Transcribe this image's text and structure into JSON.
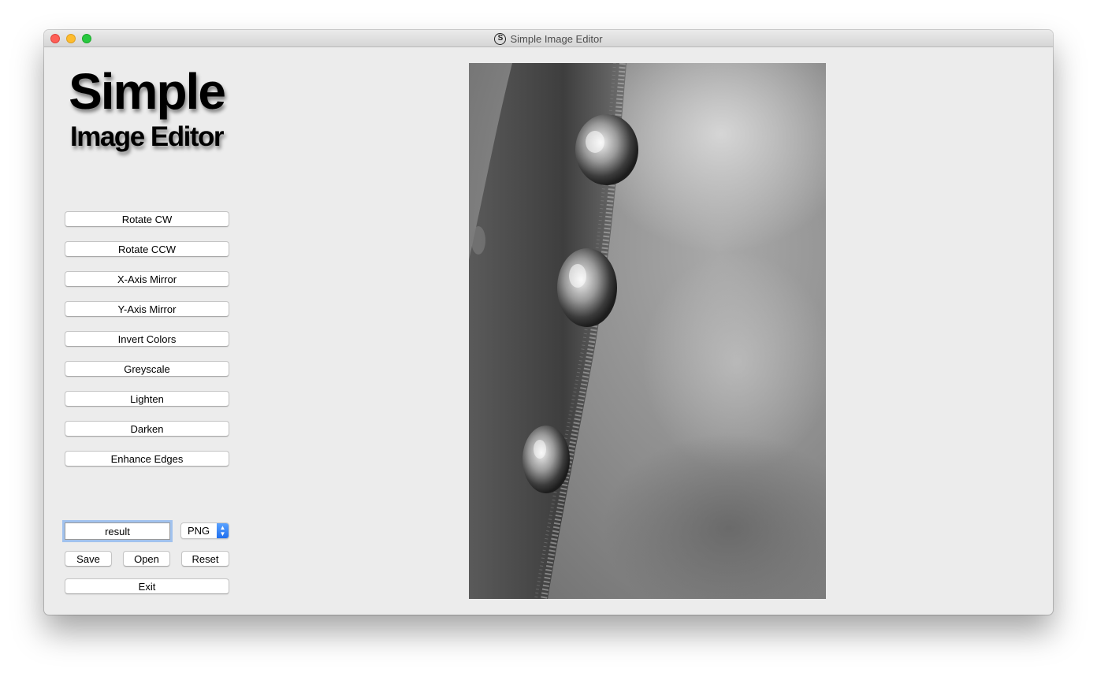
{
  "window": {
    "title": "Simple Image Editor"
  },
  "logo": {
    "line1": "Simple",
    "line2": "Image Editor"
  },
  "actions": [
    {
      "label": "Rotate CW"
    },
    {
      "label": "Rotate CCW"
    },
    {
      "label": "X-Axis Mirror"
    },
    {
      "label": "Y-Axis Mirror"
    },
    {
      "label": "Invert Colors"
    },
    {
      "label": "Greyscale"
    },
    {
      "label": "Lighten"
    },
    {
      "label": "Darken"
    },
    {
      "label": "Enhance Edges"
    }
  ],
  "file": {
    "filename": "result",
    "format": "PNG"
  },
  "buttons": {
    "save": "Save",
    "open": "Open",
    "reset": "Reset",
    "exit": "Exit"
  }
}
